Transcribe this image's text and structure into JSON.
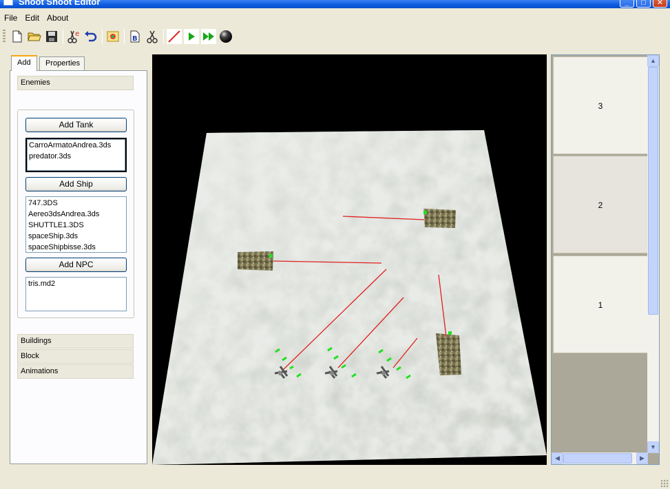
{
  "window": {
    "title": "Shoot Shoot Editor",
    "controls": [
      "minimize-icon",
      "maximize-icon",
      "close-icon"
    ]
  },
  "menu": {
    "items": [
      "File",
      "Edit",
      "About"
    ]
  },
  "toolbar": {
    "buttons": [
      {
        "name": "new-file-icon"
      },
      {
        "name": "open-folder-icon"
      },
      {
        "name": "save-disk-icon"
      },
      {
        "name": "cut-clear-icon"
      },
      {
        "name": "undo-icon"
      },
      {
        "name": "background-image-icon"
      },
      {
        "name": "document-b-icon"
      },
      {
        "name": "scissors-icon"
      },
      {
        "name": "draw-line-icon"
      },
      {
        "name": "play-icon"
      },
      {
        "name": "fast-forward-icon"
      },
      {
        "name": "sphere-icon"
      }
    ]
  },
  "left_panel": {
    "tabs": [
      "Add",
      "Properties"
    ],
    "active_tab": "Add",
    "enemies_header": "Enemies",
    "add_tank_label": "Add Tank",
    "tank_models": [
      "CarroArmatoAndrea.3ds",
      "predator.3ds"
    ],
    "add_ship_label": "Add Ship",
    "ship_models": [
      "747.3DS",
      "Aereo3dsAndrea.3ds",
      "SHUTTLE1.3DS",
      "spaceShip.3ds",
      "spaceShipbisse.3ds"
    ],
    "add_npc_label": "Add NPC",
    "npc_models": [
      "tris.md2"
    ],
    "collapsed_groups": [
      "Buildings",
      "Block",
      "Animations"
    ]
  },
  "right_panel": {
    "levels": [
      "3",
      "2",
      "1"
    ],
    "selected_level": "2"
  },
  "colors": {
    "viewport_background": "#000000",
    "terrain": "#d7dbd5",
    "link_line": "#e02020",
    "waypoint_marker": "#22e022",
    "titlebar": "#0a5ae0",
    "window_face": "#ece9d8"
  }
}
